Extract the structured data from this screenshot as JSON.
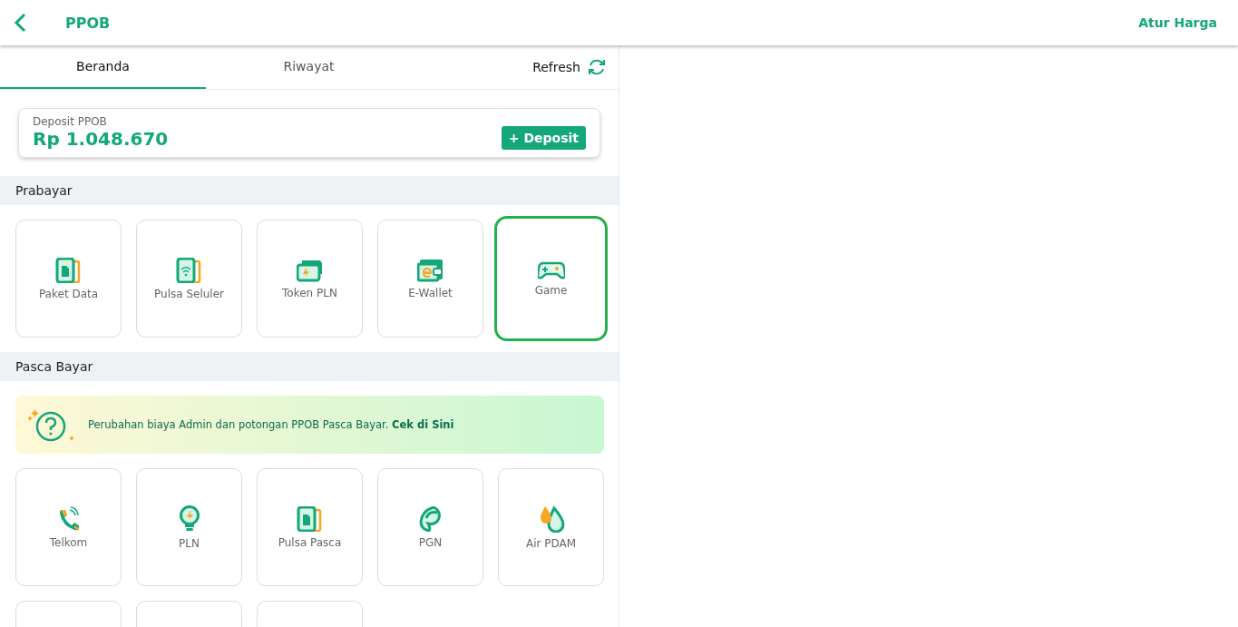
{
  "header": {
    "title": "PPOB",
    "action": "Atur Harga"
  },
  "tabs": [
    {
      "label": "Beranda",
      "selected": true
    },
    {
      "label": "Riwayat",
      "selected": false
    }
  ],
  "refresh": {
    "label": "Refresh"
  },
  "deposit": {
    "label": "Deposit PPOB",
    "amount": "Rp 1.048.670",
    "button": "+ Deposit"
  },
  "sections": [
    {
      "title": "Prabayar",
      "tiles": [
        {
          "kind": "data",
          "label": "Paket Data",
          "selected": false
        },
        {
          "kind": "pulsa",
          "label": "Pulsa Seluler",
          "selected": false
        },
        {
          "kind": "token",
          "label": "Token PLN",
          "selected": false
        },
        {
          "kind": "wallet",
          "label": "E-Wallet",
          "selected": false
        },
        {
          "kind": "game",
          "label": "Game",
          "selected": true
        }
      ]
    },
    {
      "title": "Pasca Bayar",
      "banner": {
        "text": "Perubahan biaya Admin dan potongan PPOB Pasca Bayar. ",
        "link": "Cek di Sini"
      },
      "tiles": [
        {
          "kind": "phone",
          "label": "Telkom",
          "selected": false
        },
        {
          "kind": "bulb",
          "label": "PLN",
          "selected": false
        },
        {
          "kind": "data",
          "label": "Pulsa Pasca",
          "selected": false
        },
        {
          "kind": "gas",
          "label": "PGN",
          "selected": false
        },
        {
          "kind": "water",
          "label": "Air PDAM",
          "selected": false
        },
        {
          "kind": "blank",
          "selected": false
        },
        {
          "kind": "blank",
          "selected": false
        },
        {
          "kind": "blank",
          "selected": false
        }
      ]
    }
  ]
}
